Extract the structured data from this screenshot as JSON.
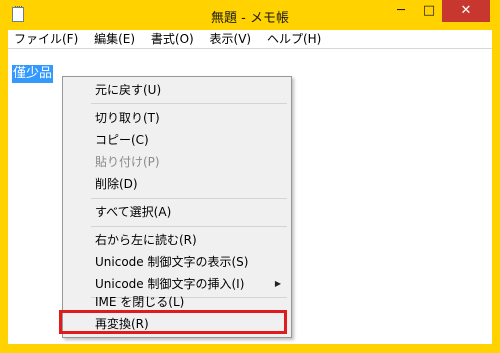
{
  "window": {
    "title": "無題 - メモ帳",
    "controls": {
      "minimize": "─",
      "maximize": "□",
      "close": "✕"
    },
    "frame_color": "#ffd200"
  },
  "menubar": {
    "items": [
      "ファイル(F)",
      "編集(E)",
      "書式(O)",
      "表示(V)",
      "ヘルプ(H)"
    ]
  },
  "editor": {
    "selected_text": "僅少品"
  },
  "context_menu": {
    "undo": "元に戻す(U)",
    "cut": "切り取り(T)",
    "copy": "コピー(C)",
    "paste": "貼り付け(P)",
    "delete": "削除(D)",
    "select_all": "すべて選択(A)",
    "rtl": "右から左に読む(R)",
    "show_unicode": "Unicode 制御文字の表示(S)",
    "insert_unicode": "Unicode 制御文字の挿入(I)",
    "close_ime": "IME を閉じる(L)",
    "reconvert": "再変換(R)"
  },
  "colors": {
    "selection": "#3399ff",
    "highlight_box": "#e01b1b"
  }
}
